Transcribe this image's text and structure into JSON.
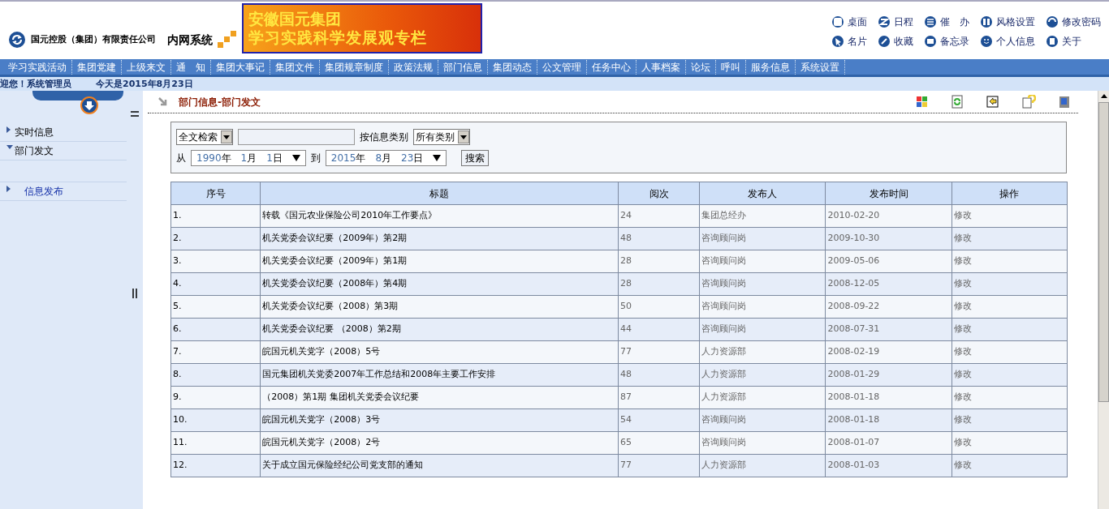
{
  "header": {
    "company": "国元控股（集团）有限责任公司",
    "system": "内网系统",
    "banner": {
      "line1": "安徽国元集团",
      "line2": "学习实践科学发展观专栏"
    },
    "quick_links": [
      "桌面",
      "日程",
      "催　办",
      "风格设置",
      "修改密码",
      "名片",
      "收藏",
      "备忘录",
      "个人信息",
      "关于"
    ]
  },
  "menu": [
    "学习实践活动",
    "集团党建",
    "上级来文",
    "通　知",
    "集团大事记",
    "集团文件",
    "集团规章制度",
    "政策法规",
    "部门信息",
    "集团动态",
    "公文管理",
    "任务中心",
    "人事档案",
    "论坛",
    "呼叫",
    "服务信息",
    "系统设置"
  ],
  "welcome": {
    "user": "迎您！系统管理员",
    "date": "今天是2015年8月23日"
  },
  "sidebar": {
    "items": [
      {
        "label": "实时信息",
        "expanded": false,
        "kind": "folder"
      },
      {
        "label": "部门发文",
        "expanded": true,
        "kind": "folder"
      },
      {
        "label": "信息发布",
        "expanded": false,
        "kind": "link"
      }
    ]
  },
  "breadcrumb": "部门信息-部门发文",
  "search": {
    "mode": "全文检索",
    "category_label": "按信息类别",
    "category": "所有类别",
    "from_label": "从",
    "to_label": "到",
    "from": {
      "year": "1990",
      "year_unit": "年",
      "month": "1",
      "month_unit": "月",
      "day": "1",
      "day_unit": "日"
    },
    "to": {
      "year": "2015",
      "year_unit": "年",
      "month": "8",
      "month_unit": "月",
      "day": "23",
      "day_unit": "日"
    },
    "button": "搜索"
  },
  "table": {
    "columns": [
      "序号",
      "标题",
      "阅次",
      "发布人",
      "发布时间",
      "操作"
    ],
    "rows": [
      [
        "1.",
        "转载《国元农业保险公司2010年工作要点》",
        "24",
        "集团总经办",
        "2010-02-20",
        "修改"
      ],
      [
        "2.",
        "机关党委会议纪要（2009年）第2期",
        "48",
        "咨询顾问岗",
        "2009-10-30",
        "修改"
      ],
      [
        "3.",
        "机关党委会议纪要（2009年）第1期",
        "28",
        "咨询顾问岗",
        "2009-05-06",
        "修改"
      ],
      [
        "4.",
        "机关党委会议纪要（2008年）第4期",
        "28",
        "咨询顾问岗",
        "2008-12-05",
        "修改"
      ],
      [
        "5.",
        "机关党委会议纪要（2008）第3期",
        "50",
        "咨询顾问岗",
        "2008-09-22",
        "修改"
      ],
      [
        "6.",
        "机关党委会议纪要 （2008）第2期",
        "44",
        "咨询顾问岗",
        "2008-07-31",
        "修改"
      ],
      [
        "7.",
        "皖国元机关党字（2008）5号",
        "77",
        "人力资源部",
        "2008-02-19",
        "修改"
      ],
      [
        "8.",
        "国元集团机关党委2007年工作总结和2008年主要工作安排",
        "48",
        "人力资源部",
        "2008-01-29",
        "修改"
      ],
      [
        "9.",
        "（2008）第1期 集团机关党委会议纪要",
        "87",
        "人力资源部",
        "2008-01-18",
        "修改"
      ],
      [
        "10.",
        "皖国元机关党字（2008）3号",
        "54",
        "咨询顾问岗",
        "2008-01-18",
        "修改"
      ],
      [
        "11.",
        "皖国元机关党字（2008）2号",
        "65",
        "咨询顾问岗",
        "2008-01-07",
        "修改"
      ],
      [
        "12.",
        "关于成立国元保险经纪公司党支部的通知",
        "77",
        "人力资源部",
        "2008-01-03",
        "修改"
      ]
    ]
  }
}
